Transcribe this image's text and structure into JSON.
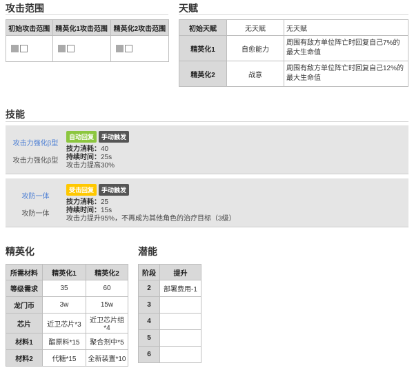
{
  "attack_range": {
    "title": "攻击范围",
    "headers": [
      "初始攻击范围",
      "精英化1攻击范围",
      "精英化2攻击范围"
    ]
  },
  "talent": {
    "title": "天赋",
    "rows": [
      {
        "label": "初始天赋",
        "name": "无天赋",
        "desc": "无天赋"
      },
      {
        "label": "精英化1",
        "name": "自愈能力",
        "desc": "周围有敌方单位阵亡时回复自己7%的最大生命值"
      },
      {
        "label": "精英化2",
        "name": "战意",
        "desc": "周围有敌方单位阵亡时回复自己12%的最大生命值"
      }
    ]
  },
  "skills": {
    "title": "技能",
    "items": [
      {
        "link": "攻击力强化β型",
        "name": "攻击力强化β型",
        "tag1": "自动回复",
        "tag2": "手动触发",
        "sp_label": "技力消耗",
        "sp": "40",
        "dur_label": "持续时间",
        "dur": "25s",
        "effect": "攻击力提高30%"
      },
      {
        "link": "攻防一体",
        "name": "攻防一体",
        "tag1": "受击回复",
        "tag2": "手动触发",
        "sp_label": "技力消耗",
        "sp": "25",
        "dur_label": "持续时间",
        "dur": "15s",
        "effect": "攻击力提升95%，不再成为其他角色的治疗目标（3级）"
      }
    ]
  },
  "elite": {
    "title": "精英化",
    "headers": [
      "所需材料",
      "精英化1",
      "精英化2"
    ],
    "rows": [
      [
        "等级需求",
        "35",
        "60"
      ],
      [
        "龙门币",
        "3w",
        "15w"
      ],
      [
        "芯片",
        "近卫芯片*3",
        "近卫芯片组*4"
      ],
      [
        "材料1",
        "酯原料*15",
        "聚合剂中*5"
      ],
      [
        "材料2",
        "代糖*15",
        "全新装置*10"
      ]
    ]
  },
  "potential": {
    "title": "潜能",
    "headers": [
      "阶段",
      "提升"
    ],
    "rows": [
      [
        "2",
        "部署费用-1"
      ],
      [
        "3",
        ""
      ],
      [
        "4",
        ""
      ],
      [
        "5",
        ""
      ],
      [
        "6",
        ""
      ]
    ]
  },
  "colors": {
    "tag_auto": "#8cc63f",
    "tag_hit": "#ffc800",
    "tag_manual": "#555555",
    "link": "#4d7fd4"
  }
}
